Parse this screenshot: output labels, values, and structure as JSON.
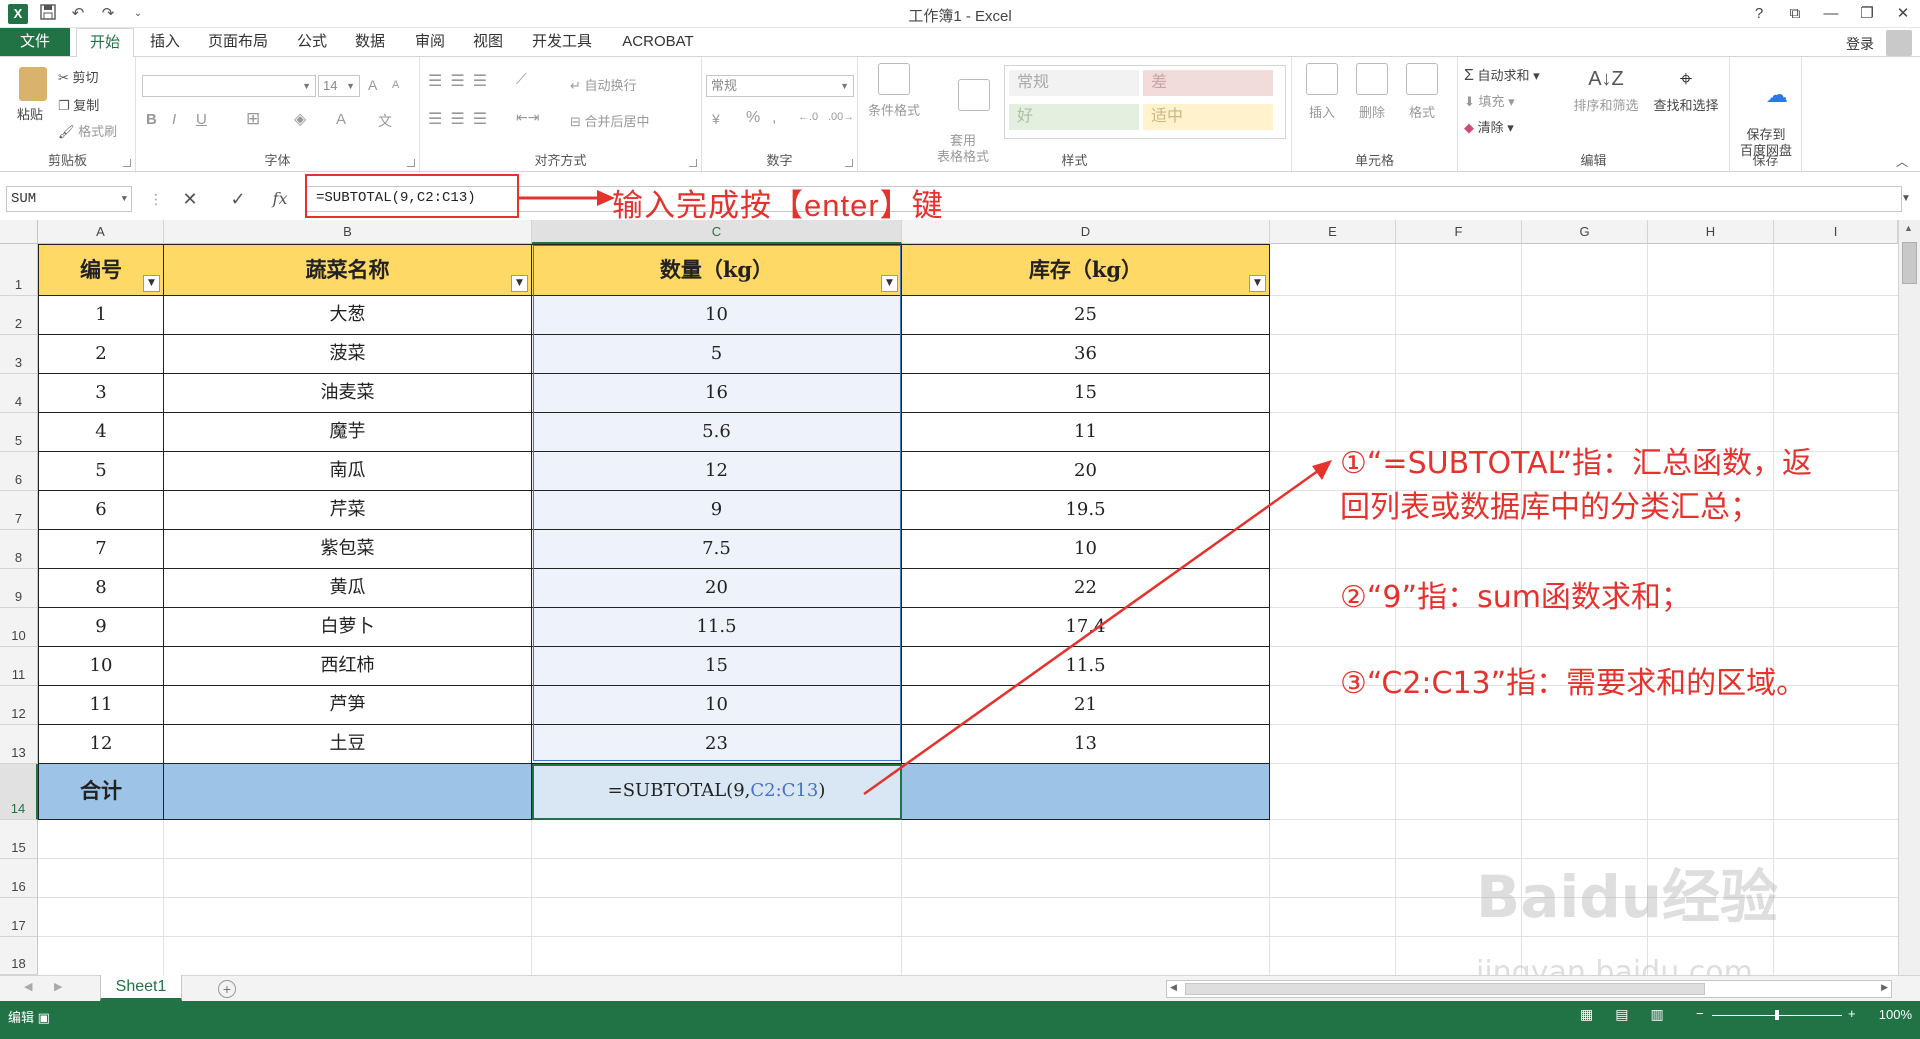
{
  "window": {
    "title": "工作簿1 - Excel",
    "help": "?",
    "minimize": "—",
    "restore": "❐",
    "close": "✕",
    "ribbon_opts": "⧉"
  },
  "qat": {
    "app_icon": "X",
    "save": "💾",
    "undo": "↶",
    "redo": "↷",
    "customize": "⌄"
  },
  "tabs": [
    {
      "label": "文件"
    },
    {
      "label": "开始"
    },
    {
      "label": "插入"
    },
    {
      "label": "页面布局"
    },
    {
      "label": "公式"
    },
    {
      "label": "数据"
    },
    {
      "label": "审阅"
    },
    {
      "label": "视图"
    },
    {
      "label": "开发工具"
    },
    {
      "label": "ACROBAT"
    }
  ],
  "signin": "登录",
  "ribbon": {
    "clipboard": {
      "paste": "粘贴",
      "cut": "剪切",
      "copy": "复制",
      "format_painter": "格式刷",
      "label": "剪贴板"
    },
    "font": {
      "name": "",
      "size": "14",
      "bold": "B",
      "italic": "I",
      "underline": "U",
      "grow": "A",
      "shrink": "A",
      "font_color": "A",
      "phonetic": "文",
      "label": "字体"
    },
    "alignment": {
      "wrap": "自动换行",
      "merge": "合并后居中",
      "label": "对齐方式"
    },
    "number": {
      "format": "常规",
      "percent": "%",
      "comma": ",",
      "label": "数字"
    },
    "styles": {
      "conditional": "条件格式",
      "table_format": "套用\n表格格式",
      "normal": "常规",
      "bad": "差",
      "good": "好",
      "neutral": "适中",
      "label": "样式"
    },
    "cells": {
      "insert": "插入",
      "delete": "删除",
      "format": "格式",
      "label": "单元格"
    },
    "editing": {
      "autosum": "自动求和",
      "fill": "填充",
      "clear": "清除",
      "sort": "排序和筛选",
      "find": "查找和选择",
      "label": "编辑"
    },
    "save": {
      "save_to": "保存到\n百度网盘",
      "label": "保存"
    }
  },
  "formula_bar": {
    "name_box": "SUM",
    "cancel": "✕",
    "enter": "✓",
    "fx": "fx",
    "formula": "=SUBTOTAL(9,C2:C13)"
  },
  "callout_enter": "输入完成按【enter】键",
  "columns": [
    "A",
    "B",
    "C",
    "D",
    "E",
    "F",
    "G",
    "H",
    "I"
  ],
  "table": {
    "headers": [
      "编号",
      "蔬菜名称",
      "数量（kg）",
      "库存（kg）"
    ],
    "rows": [
      [
        "1",
        "大葱",
        "10",
        "25"
      ],
      [
        "2",
        "菠菜",
        "5",
        "36"
      ],
      [
        "3",
        "油麦菜",
        "16",
        "15"
      ],
      [
        "4",
        "魔芋",
        "5.6",
        "11"
      ],
      [
        "5",
        "南瓜",
        "12",
        "20"
      ],
      [
        "6",
        "芹菜",
        "9",
        "19.5"
      ],
      [
        "7",
        "紫包菜",
        "7.5",
        "10"
      ],
      [
        "8",
        "黄瓜",
        "20",
        "22"
      ],
      [
        "9",
        "白萝卜",
        "11.5",
        "17.4"
      ],
      [
        "10",
        "西红柿",
        "15",
        "11.5"
      ],
      [
        "11",
        "芦笋",
        "10",
        "21"
      ],
      [
        "12",
        "土豆",
        "23",
        "13"
      ]
    ],
    "total_label": "合计",
    "total_formula_prefix": "=SUBTOTAL(9,",
    "total_formula_ref": "C2:C13",
    "total_formula_suffix": ")"
  },
  "row_numbers": [
    "1",
    "2",
    "3",
    "4",
    "5",
    "6",
    "7",
    "8",
    "9",
    "10",
    "11",
    "12",
    "13",
    "14",
    "15",
    "16",
    "17",
    "18"
  ],
  "notes": {
    "n1_line1": "①“=SUBTOTAL”指：汇总函数，返",
    "n1_line2": "回列表或数据库中的分类汇总；",
    "n2": "②“9”指：sum函数求和；",
    "n3": "③“C2:C13”指：需要求和的区域。"
  },
  "watermark": {
    "logo": "Baidu经验",
    "url": "jingyan.baidu.com"
  },
  "sheet": {
    "name": "Sheet1",
    "add": "+"
  },
  "status": {
    "mode": "编辑",
    "zoom": "100%"
  },
  "colors": {
    "excel_green": "#217346",
    "header_yellow": "#ffd966",
    "total_blue": "#9dc3e6",
    "annotation_red": "#e5322d",
    "ref_blue": "#4472c4"
  }
}
